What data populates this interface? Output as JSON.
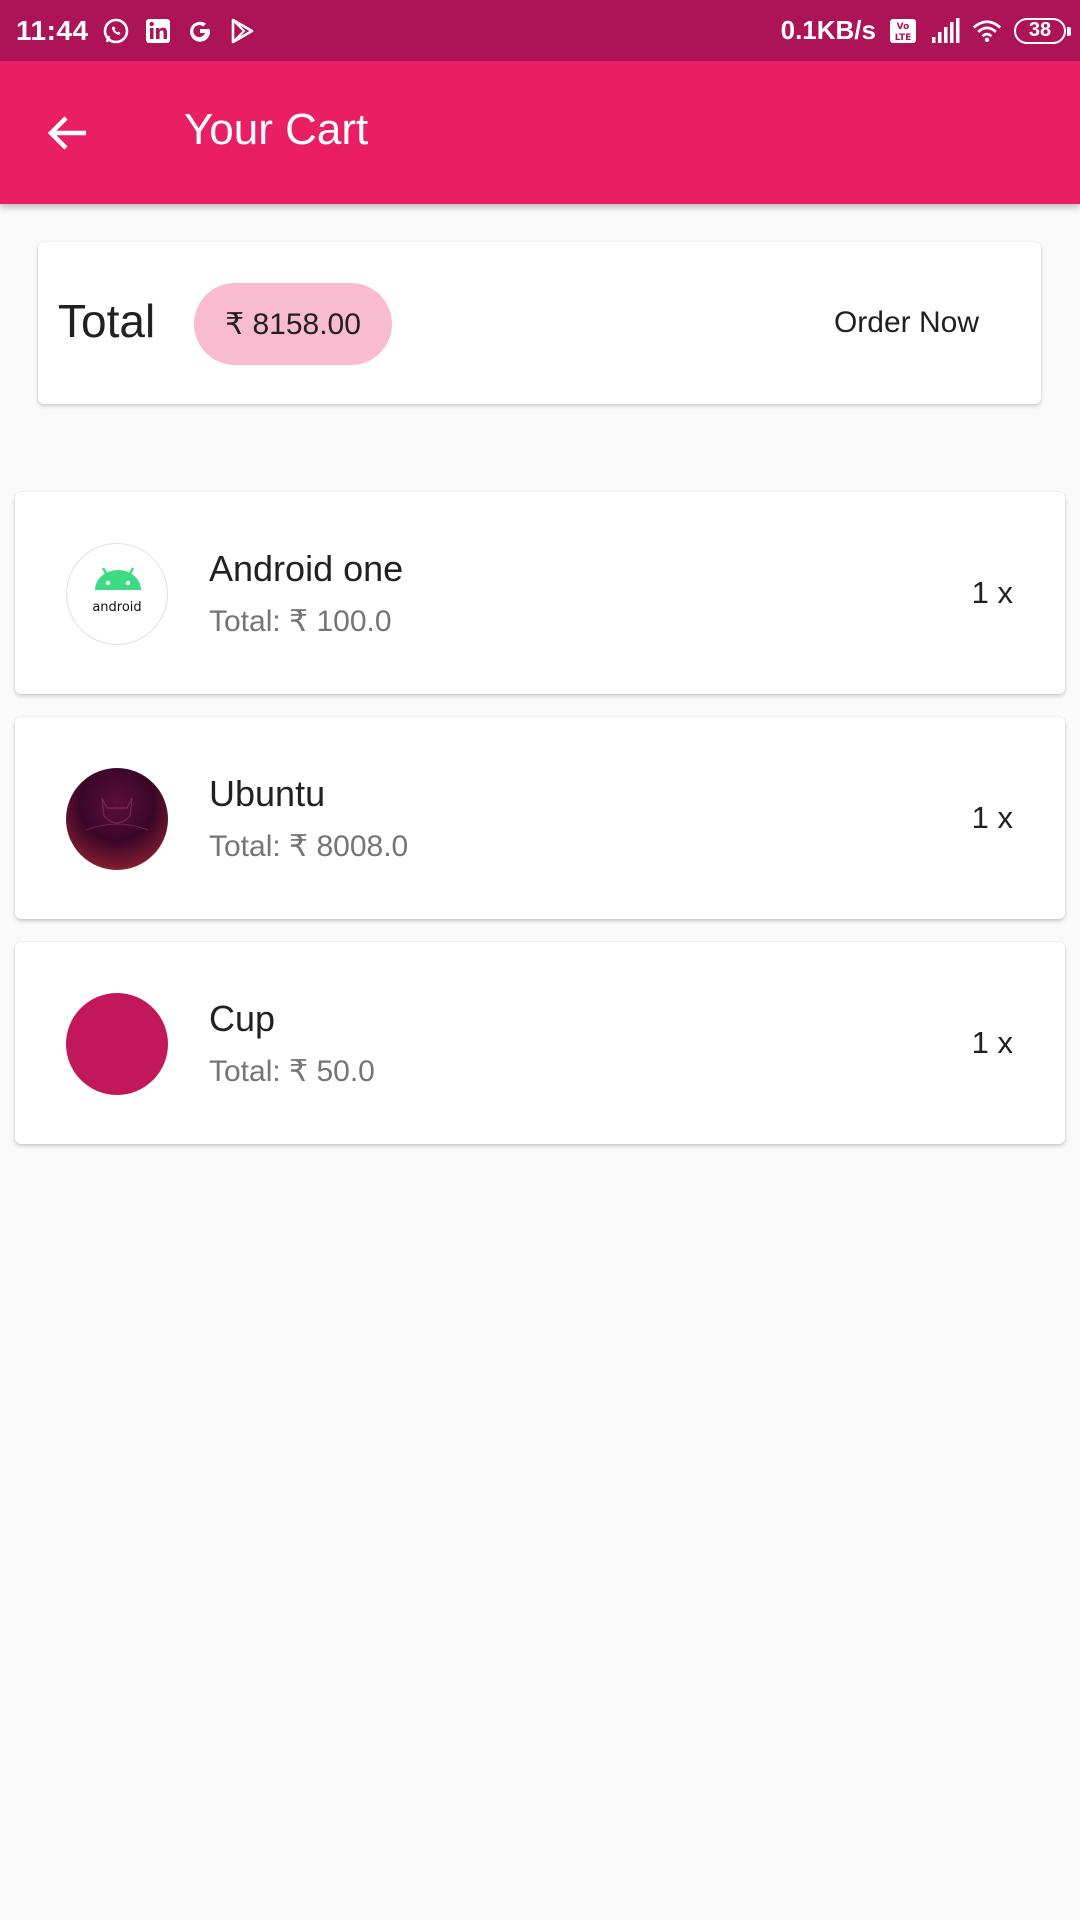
{
  "status_bar": {
    "time": "11:44",
    "speed": "0.1KB/s",
    "battery": "38",
    "icons": [
      "whatsapp-icon",
      "linkedin-icon",
      "google-icon",
      "play-store-icon",
      "volte-icon",
      "signal-icon",
      "wifi-icon"
    ]
  },
  "app_bar": {
    "title": "Your Cart",
    "back_icon": "arrow-back-icon",
    "color": "#e91e63"
  },
  "summary": {
    "total_label": "Total",
    "total_amount": "₹ 8158.00",
    "order_button": "Order Now",
    "chip_color": "#f8bbd0"
  },
  "items": [
    {
      "name": "Android one",
      "total": "Total: ₹ 100.0",
      "qty": "1 x",
      "avatar_text": "android"
    },
    {
      "name": "Ubuntu",
      "total": "Total: ₹ 8008.0",
      "qty": "1 x"
    },
    {
      "name": "Cup",
      "total": "Total: ₹ 50.0",
      "qty": "1 x",
      "avatar_color": "#c2185b"
    }
  ]
}
